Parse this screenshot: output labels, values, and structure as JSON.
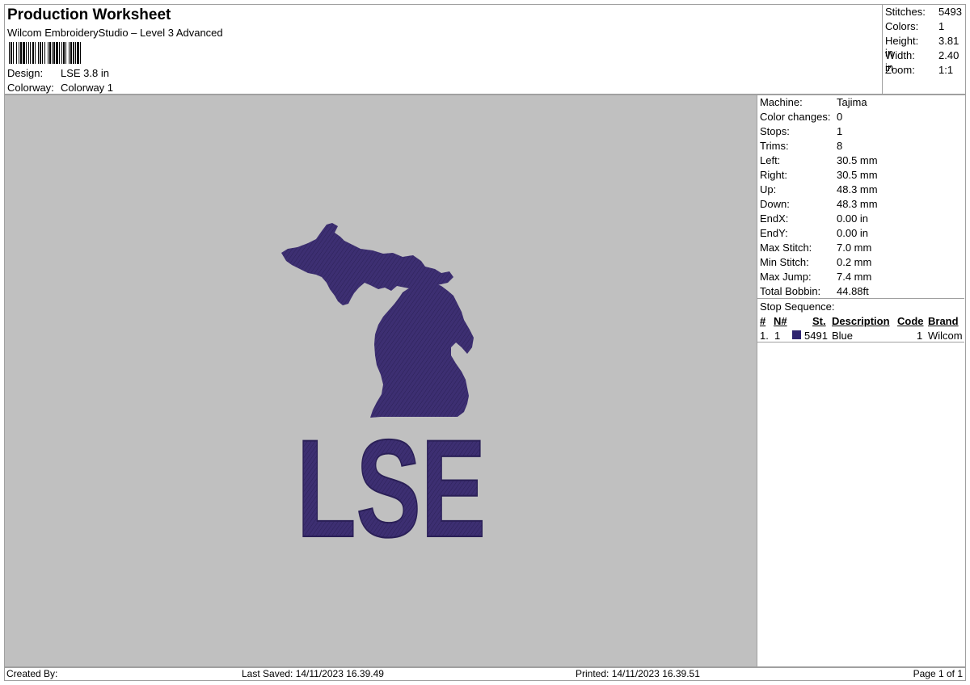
{
  "header": {
    "title": "Production Worksheet",
    "subtitle": "Wilcom EmbroideryStudio – Level 3 Advanced",
    "design_label": "Design:",
    "design_value": "LSE 3.8 in",
    "colorway_label": "Colorway:",
    "colorway_value": "Colorway 1"
  },
  "stats": [
    {
      "label": "Stitches:",
      "value": "5493"
    },
    {
      "label": "Colors:",
      "value": "1"
    },
    {
      "label": "Height:",
      "value": "3.81 in"
    },
    {
      "label": "Width:",
      "value": "2.40 in"
    },
    {
      "label": "Zoom:",
      "value": "1:1"
    }
  ],
  "design": {
    "text": "LSE",
    "thread_color": "#3d2f72",
    "canvas_color": "#c0c0c0"
  },
  "machine_info": [
    {
      "label": "Machine:",
      "value": "Tajima"
    },
    {
      "label": "Color changes:",
      "value": "0"
    },
    {
      "label": "Stops:",
      "value": "1"
    },
    {
      "label": "Trims:",
      "value": "8"
    },
    {
      "label": "Left:",
      "value": "30.5 mm"
    },
    {
      "label": "Right:",
      "value": "30.5 mm"
    },
    {
      "label": "Up:",
      "value": "48.3 mm"
    },
    {
      "label": "Down:",
      "value": "48.3 mm"
    },
    {
      "label": "EndX:",
      "value": "0.00 in"
    },
    {
      "label": "EndY:",
      "value": "0.00 in"
    },
    {
      "label": "Max Stitch:",
      "value": "7.0 mm"
    },
    {
      "label": "Min Stitch:",
      "value": "0.2 mm"
    },
    {
      "label": "Max Jump:",
      "value": "7.4 mm"
    },
    {
      "label": "Total Bobbin:",
      "value": "44.88ft"
    }
  ],
  "stop_sequence": {
    "title": "Stop Sequence:",
    "headers": {
      "num": "#",
      "n": "N#",
      "st": "St.",
      "description": "Description",
      "code": "Code",
      "brand": "Brand"
    },
    "rows": [
      {
        "num": "1.",
        "n": "1",
        "swatch_color": "#2e2470",
        "st": "5491",
        "description": "Blue",
        "code": "1",
        "brand": "Wilcom"
      }
    ]
  },
  "footer": {
    "created_by": "Created By:",
    "last_saved": "Last Saved: 14/11/2023 16.39.49",
    "printed": "Printed: 14/11/2023 16.39.51",
    "page": "Page 1 of 1"
  }
}
